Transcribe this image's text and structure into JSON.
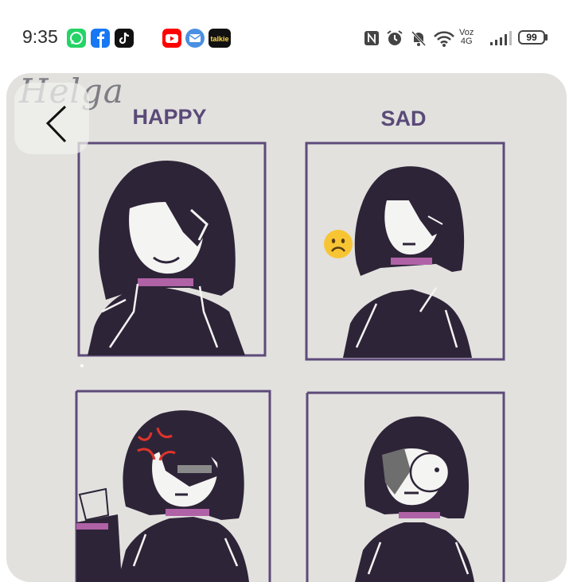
{
  "status_bar": {
    "time": "9:35",
    "network_label_top": "Voz",
    "network_label_bottom": "4G",
    "battery_level": "99",
    "notification_icons": [
      "whatsapp-icon",
      "facebook-icon",
      "tiktok-icon",
      "youtube-icon",
      "mail-icon",
      "talkie-icon"
    ],
    "system_icons": [
      "nfc-icon",
      "alarm-icon",
      "mute-notifications-icon",
      "wifi-icon",
      "signal-icon",
      "battery-icon"
    ]
  },
  "talkie_label": "talkie",
  "artwork": {
    "signature": "Helga",
    "panels": [
      {
        "label": "HAPPY"
      },
      {
        "label": "SAD"
      },
      {
        "label": ""
      },
      {
        "label": ""
      }
    ],
    "colors": {
      "background": "#e2e1de",
      "frame": "#5d4a7a",
      "label": "#5a4a78",
      "hair": "#2e2438",
      "face": "#f4f4f2",
      "collar": "#b062a6"
    },
    "sticker": "sad-face-emoji"
  }
}
